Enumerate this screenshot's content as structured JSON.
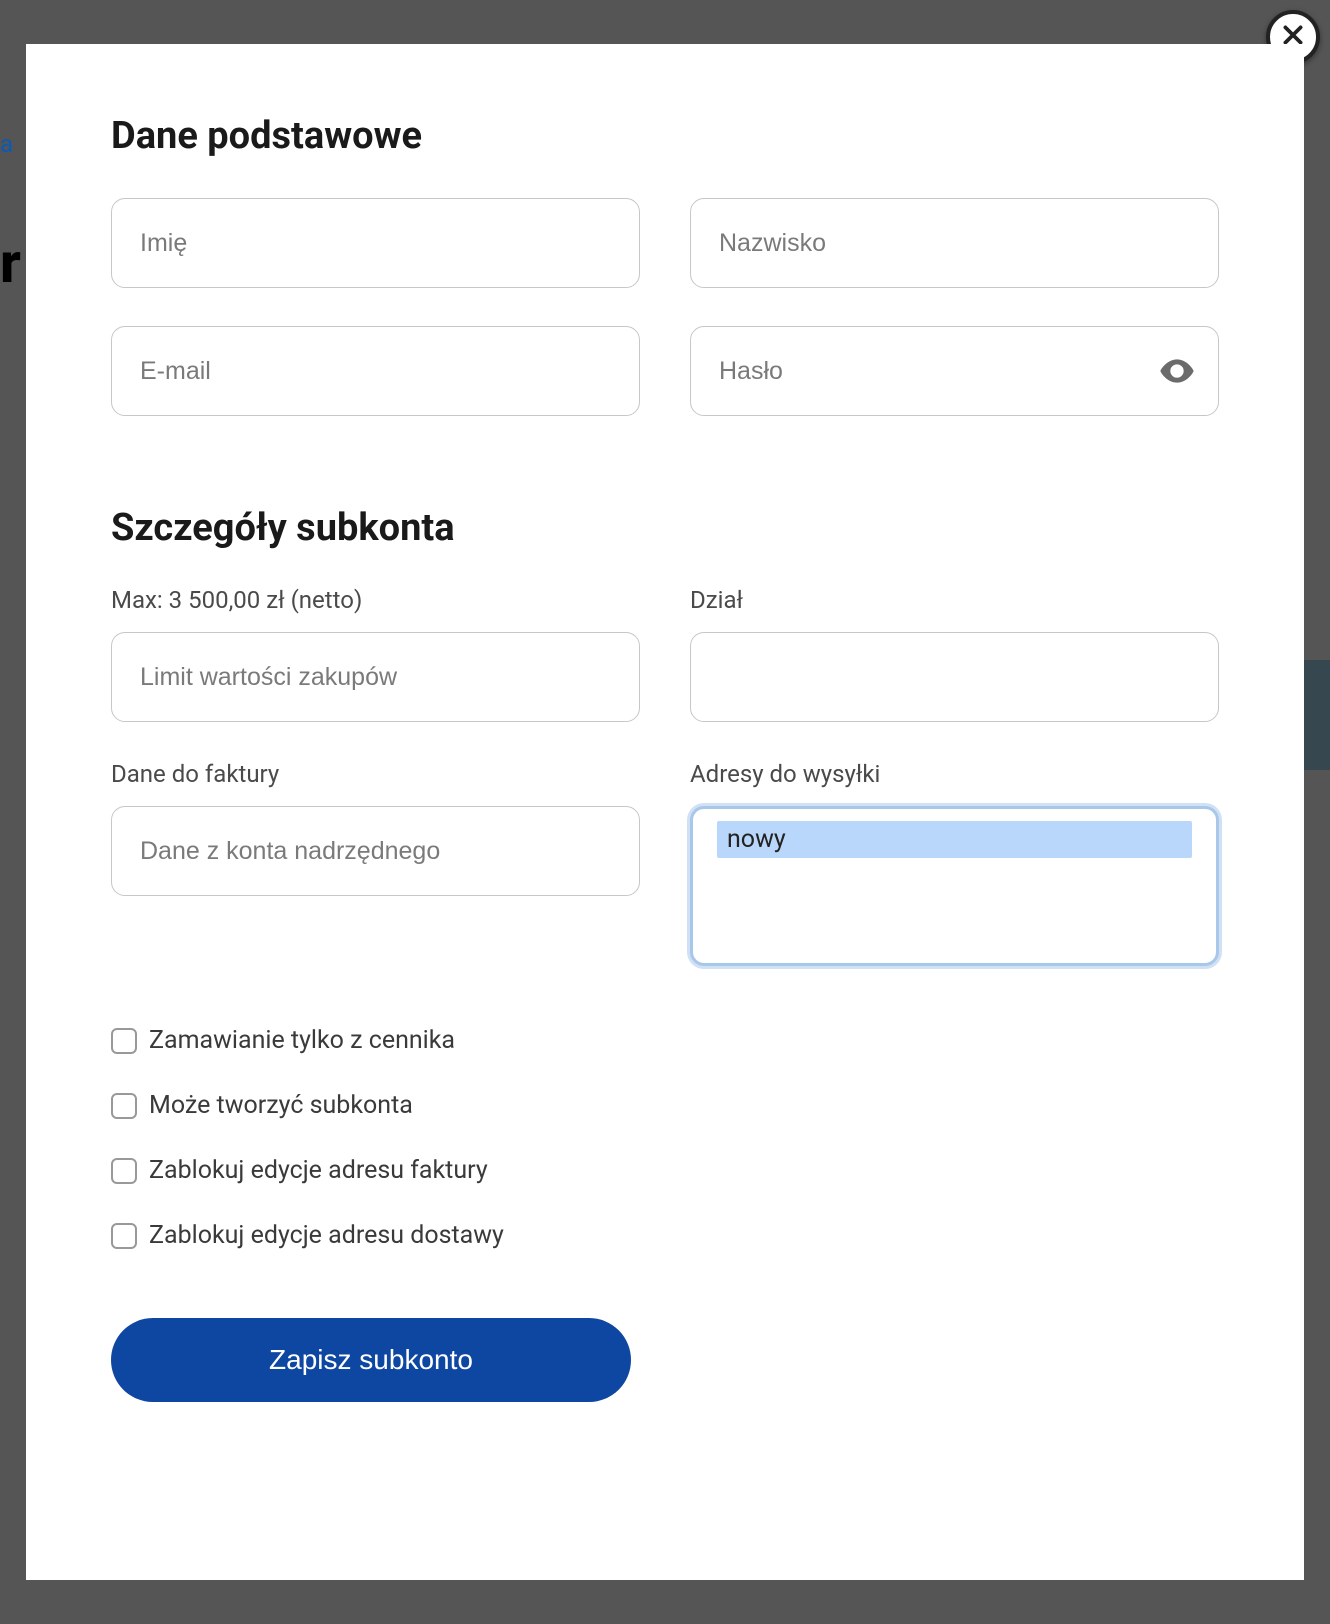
{
  "backdrop": {
    "link_fragment": "a",
    "heading_fragment": "r"
  },
  "modal": {
    "close_label": "close",
    "basic": {
      "title": "Dane podstawowe",
      "first_name_placeholder": "Imię",
      "last_name_placeholder": "Nazwisko",
      "email_placeholder": "E-mail",
      "password_placeholder": "Hasło"
    },
    "details": {
      "title": "Szczegóły subkonta",
      "max_label": "Max: 3 500,00 zł (netto)",
      "limit_placeholder": "Limit wartości zakupów",
      "department_label": "Dział",
      "invoice_label": "Dane do faktury",
      "invoice_placeholder": "Dane z konta nadrzędnego",
      "shipping_label": "Adresy do wysyłki",
      "shipping_options": [
        "nowy"
      ]
    },
    "checkboxes": {
      "order_pricelist": "Zamawianie tylko z cennika",
      "create_subaccounts": "Może tworzyć subkonta",
      "block_invoice_address": "Zablokuj edycje adresu faktury",
      "block_delivery_address": "Zablokuj edycje adresu dostawy"
    },
    "submit_label": "Zapisz subkonto"
  }
}
